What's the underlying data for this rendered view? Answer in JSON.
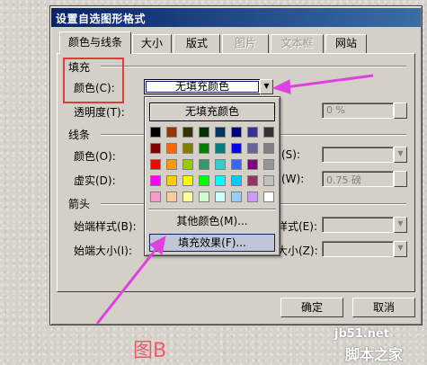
{
  "dialog": {
    "title": "设置自选图形格式",
    "tabs": [
      {
        "label": "颜色与线条",
        "state": "active"
      },
      {
        "label": "大小",
        "state": "normal"
      },
      {
        "label": "版式",
        "state": "normal"
      },
      {
        "label": "图片",
        "state": "disabled"
      },
      {
        "label": "文本框",
        "state": "disabled"
      },
      {
        "label": "网站",
        "state": "normal"
      }
    ],
    "fill": {
      "section_label": "填充",
      "color_label": "颜色(C):",
      "color_value": "无填充颜色",
      "transparency_label": "透明度(T):",
      "transparency_value": "0 %"
    },
    "line": {
      "section_label": "线条",
      "color_label": "颜色(O):",
      "dash_label": "虚实(D):",
      "style_label": "(S):",
      "weight_label": "(W):",
      "weight_value": "0.75 磅"
    },
    "arrows": {
      "section_label": "箭头",
      "begin_style_label": "始端样式(B):",
      "begin_size_label": "始端大小(I):",
      "end_style_label": "样式(E):",
      "end_size_label": "大小(Z):"
    },
    "ok_label": "确定",
    "cancel_label": "取消"
  },
  "color_popup": {
    "no_fill_label": "无填充颜色",
    "more_colors_label": "其他颜色(M)...",
    "fill_effects_label": "填充效果(F)...",
    "palette": [
      [
        "#000000",
        "#993300",
        "#333300",
        "#003300",
        "#003366",
        "#000080",
        "#333399",
        "#333333"
      ],
      [
        "#800000",
        "#FF6600",
        "#808000",
        "#008000",
        "#008080",
        "#0000FF",
        "#666699",
        "#808080"
      ],
      [
        "#FF0000",
        "#FF9900",
        "#99CC00",
        "#339966",
        "#33CCCC",
        "#3366FF",
        "#800080",
        "#969696"
      ],
      [
        "#FF00FF",
        "#FFCC00",
        "#FFFF00",
        "#00FF00",
        "#00FFFF",
        "#00CCFF",
        "#993366",
        "#C0C0C0"
      ],
      [
        "#FF99CC",
        "#FFCC99",
        "#FFFF99",
        "#CCFFCC",
        "#CCFFFF",
        "#99CCFF",
        "#CC99FF",
        "#FFFFFF"
      ]
    ]
  },
  "annotations": {
    "caption": "图B",
    "watermark_site": "jb51.net",
    "watermark_name": "脚本之家",
    "highlight_color": "#E03B3B",
    "arrow_color": "#E040E0"
  }
}
